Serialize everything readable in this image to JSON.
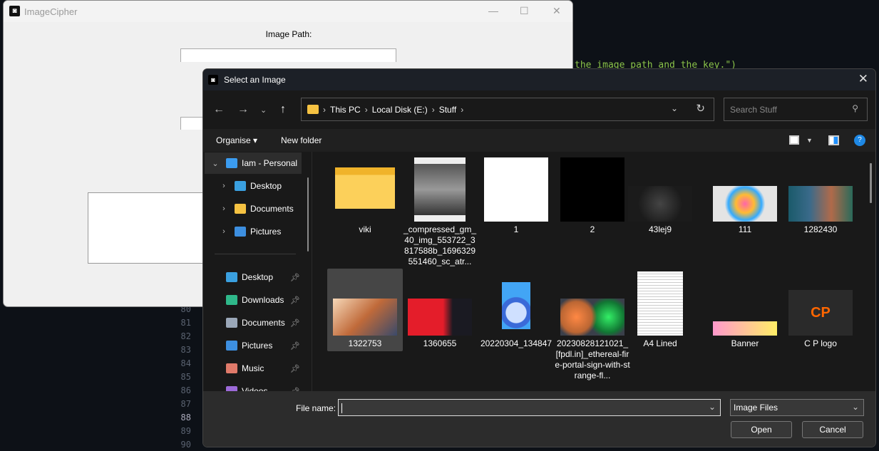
{
  "background": {
    "code_line": "the image path and the key.\")",
    "line_numbers": [
      "80",
      "81",
      "82",
      "83",
      "84",
      "85",
      "86",
      "87",
      "88",
      "89",
      "90"
    ]
  },
  "app": {
    "title": "ImageCipher",
    "image_path_label": "Image Path:",
    "image_path_value": "",
    "key_value": ""
  },
  "dialog": {
    "title": "Select an Image",
    "breadcrumb": [
      "This PC",
      "Local Disk (E:)",
      "Stuff"
    ],
    "search_placeholder": "Search Stuff",
    "organise_label": "Organise ▾",
    "new_folder_label": "New folder",
    "nav": {
      "top": [
        {
          "label": "Iam - Personal",
          "icon": "onedrive-icon"
        },
        {
          "label": "Desktop",
          "icon": "desktop-icon"
        },
        {
          "label": "Documents",
          "icon": "folder-icon"
        },
        {
          "label": "Pictures",
          "icon": "pictures-icon"
        }
      ],
      "quick": [
        {
          "label": "Desktop",
          "icon": "desktop-icon"
        },
        {
          "label": "Downloads",
          "icon": "download-icon"
        },
        {
          "label": "Documents",
          "icon": "document-icon"
        },
        {
          "label": "Pictures",
          "icon": "pictures-icon"
        },
        {
          "label": "Music",
          "icon": "music-icon"
        },
        {
          "label": "Videos",
          "icon": "videos-icon"
        }
      ]
    },
    "files": [
      {
        "name": "viki",
        "thumb": "folder-icon"
      },
      {
        "name": "_compressed_gm_40_img_553722_3817588b_1696329551460_sc_atr...",
        "thumb": "photo-bw"
      },
      {
        "name": "1",
        "thumb": "logo-white"
      },
      {
        "name": "2",
        "thumb": "logo-black"
      },
      {
        "name": "43lej9",
        "thumb": "deer-dark"
      },
      {
        "name": "111",
        "thumb": "butterfly"
      },
      {
        "name": "1282430",
        "thumb": "game-art"
      },
      {
        "name": "1322753",
        "thumb": "painting",
        "selected": true
      },
      {
        "name": "1360655",
        "thumb": "red-warrior"
      },
      {
        "name": "20220304_134847",
        "thumb": "blue-toggle"
      },
      {
        "name": "20230828121021_[fpdl.in]_ethereal-fire-portal-sign-with-strange-fl...",
        "thumb": "portals"
      },
      {
        "name": "A4 Lined",
        "thumb": "lined-paper"
      },
      {
        "name": "Banner",
        "thumb": "banner"
      },
      {
        "name": "C P logo",
        "thumb": "cp-logo"
      }
    ],
    "file_name_label": "File name:",
    "file_name_value": "",
    "filter_value": "Image Files",
    "open_label": "Open",
    "cancel_label": "Cancel",
    "accent": "#0078d4"
  }
}
